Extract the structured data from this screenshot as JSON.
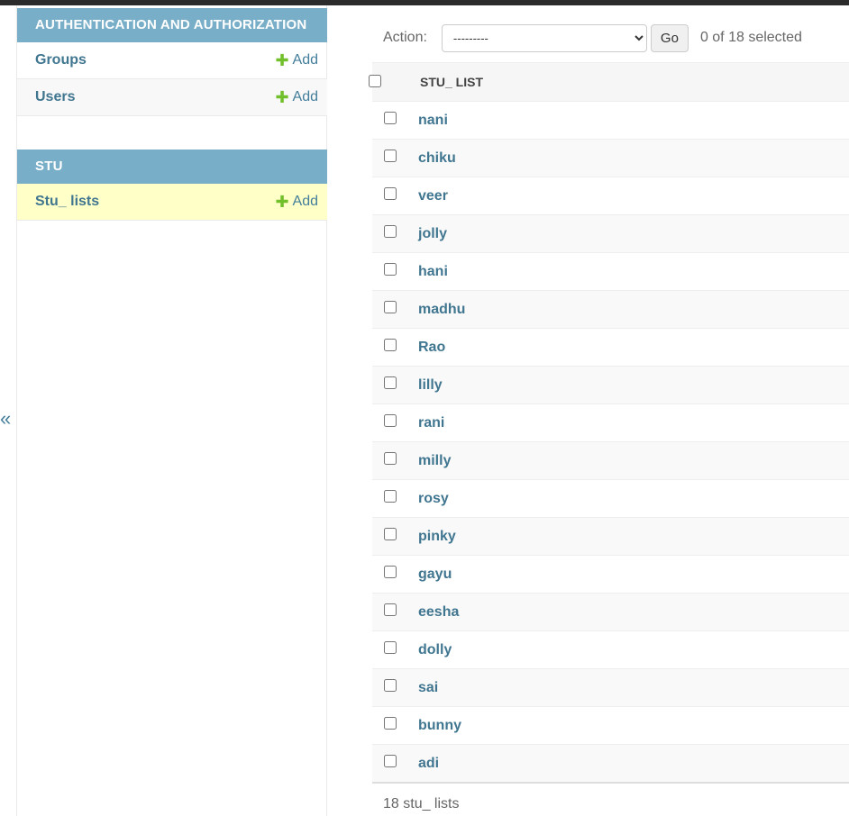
{
  "sidebar": {
    "collapse_glyph": "«",
    "modules": [
      {
        "header": "AUTHENTICATION AND AUTHORIZATION",
        "models": [
          {
            "name": "Groups",
            "add_label": "Add"
          },
          {
            "name": "Users",
            "add_label": "Add"
          }
        ]
      },
      {
        "header": "STU",
        "models": [
          {
            "name": "Stu_ lists",
            "add_label": "Add"
          }
        ]
      }
    ],
    "plus_glyph": "✚"
  },
  "actions": {
    "label": "Action:",
    "selected_option": "---------",
    "go_label": "Go",
    "selected_count": "0 of 18 selected"
  },
  "results": {
    "column_header": "STU_ LIST",
    "rows": [
      "nani",
      "chiku",
      "veer",
      "jolly",
      "hani",
      "madhu",
      "Rao",
      "lilly",
      "rani",
      "milly",
      "rosy",
      "pinky",
      "gayu",
      "eesha",
      "dolly",
      "sai",
      "bunny",
      "adi"
    ]
  },
  "paginator": "18 stu_ lists",
  "colors": {
    "module_header": "#79aec8",
    "link": "#417690",
    "add_plus": "#70bf2b",
    "current_row": "#ffffc8"
  }
}
